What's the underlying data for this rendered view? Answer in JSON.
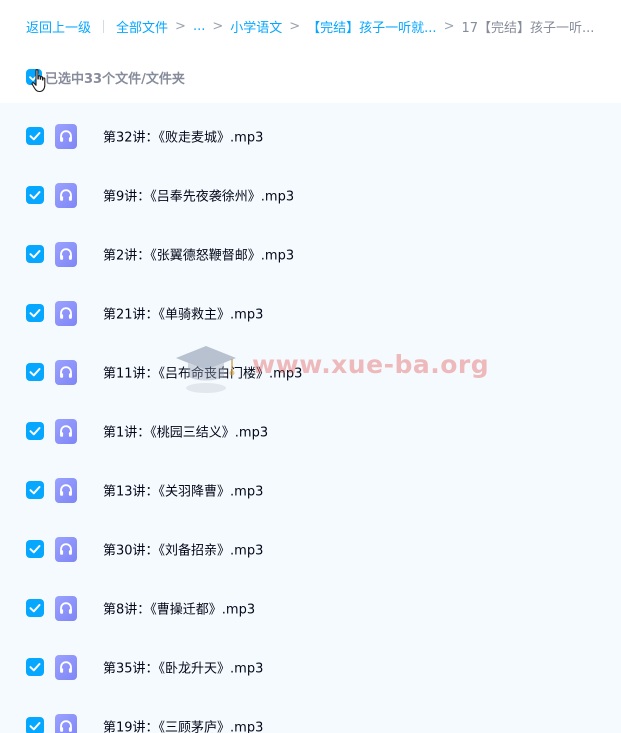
{
  "breadcrumb": {
    "back": "返回上一级",
    "all_files": "全部文件",
    "ellipsis": "...",
    "level_1": "小学语文",
    "level_2": "【完结】孩子一听就...",
    "current": "17【完结】孩子一听..."
  },
  "selection": {
    "summary": "已选中33个文件/文件夹"
  },
  "files": [
    {
      "name": "第32讲：《败走麦城》.mp3"
    },
    {
      "name": "第9讲：《吕奉先夜袭徐州》.mp3"
    },
    {
      "name": "第2讲：《张翼德怒鞭督邮》.mp3"
    },
    {
      "name": "第21讲：《单骑救主》.mp3"
    },
    {
      "name": "第11讲：《吕布命丧白门楼》.mp3"
    },
    {
      "name": "第1讲：《桃园三结义》.mp3"
    },
    {
      "name": "第13讲：《关羽降曹》.mp3"
    },
    {
      "name": "第30讲：《刘备招亲》.mp3"
    },
    {
      "name": "第8讲：《曹操迁都》.mp3"
    },
    {
      "name": "第35讲：《卧龙升天》.mp3"
    },
    {
      "name": "第19讲：《三顾茅庐》.mp3"
    }
  ],
  "watermark": {
    "text": "www.xue-ba.org"
  },
  "colors": {
    "accent": "#06a7ff",
    "list_background": "#f5fafe",
    "audio_icon": "#7f85f5",
    "watermark": "#e25050"
  },
  "icons": {
    "checkbox": "checkbox-checked-icon",
    "file": "audio-file-icon",
    "cursor": "hand-pointer-icon",
    "watermark_logo": "graduation-cap-icon"
  }
}
